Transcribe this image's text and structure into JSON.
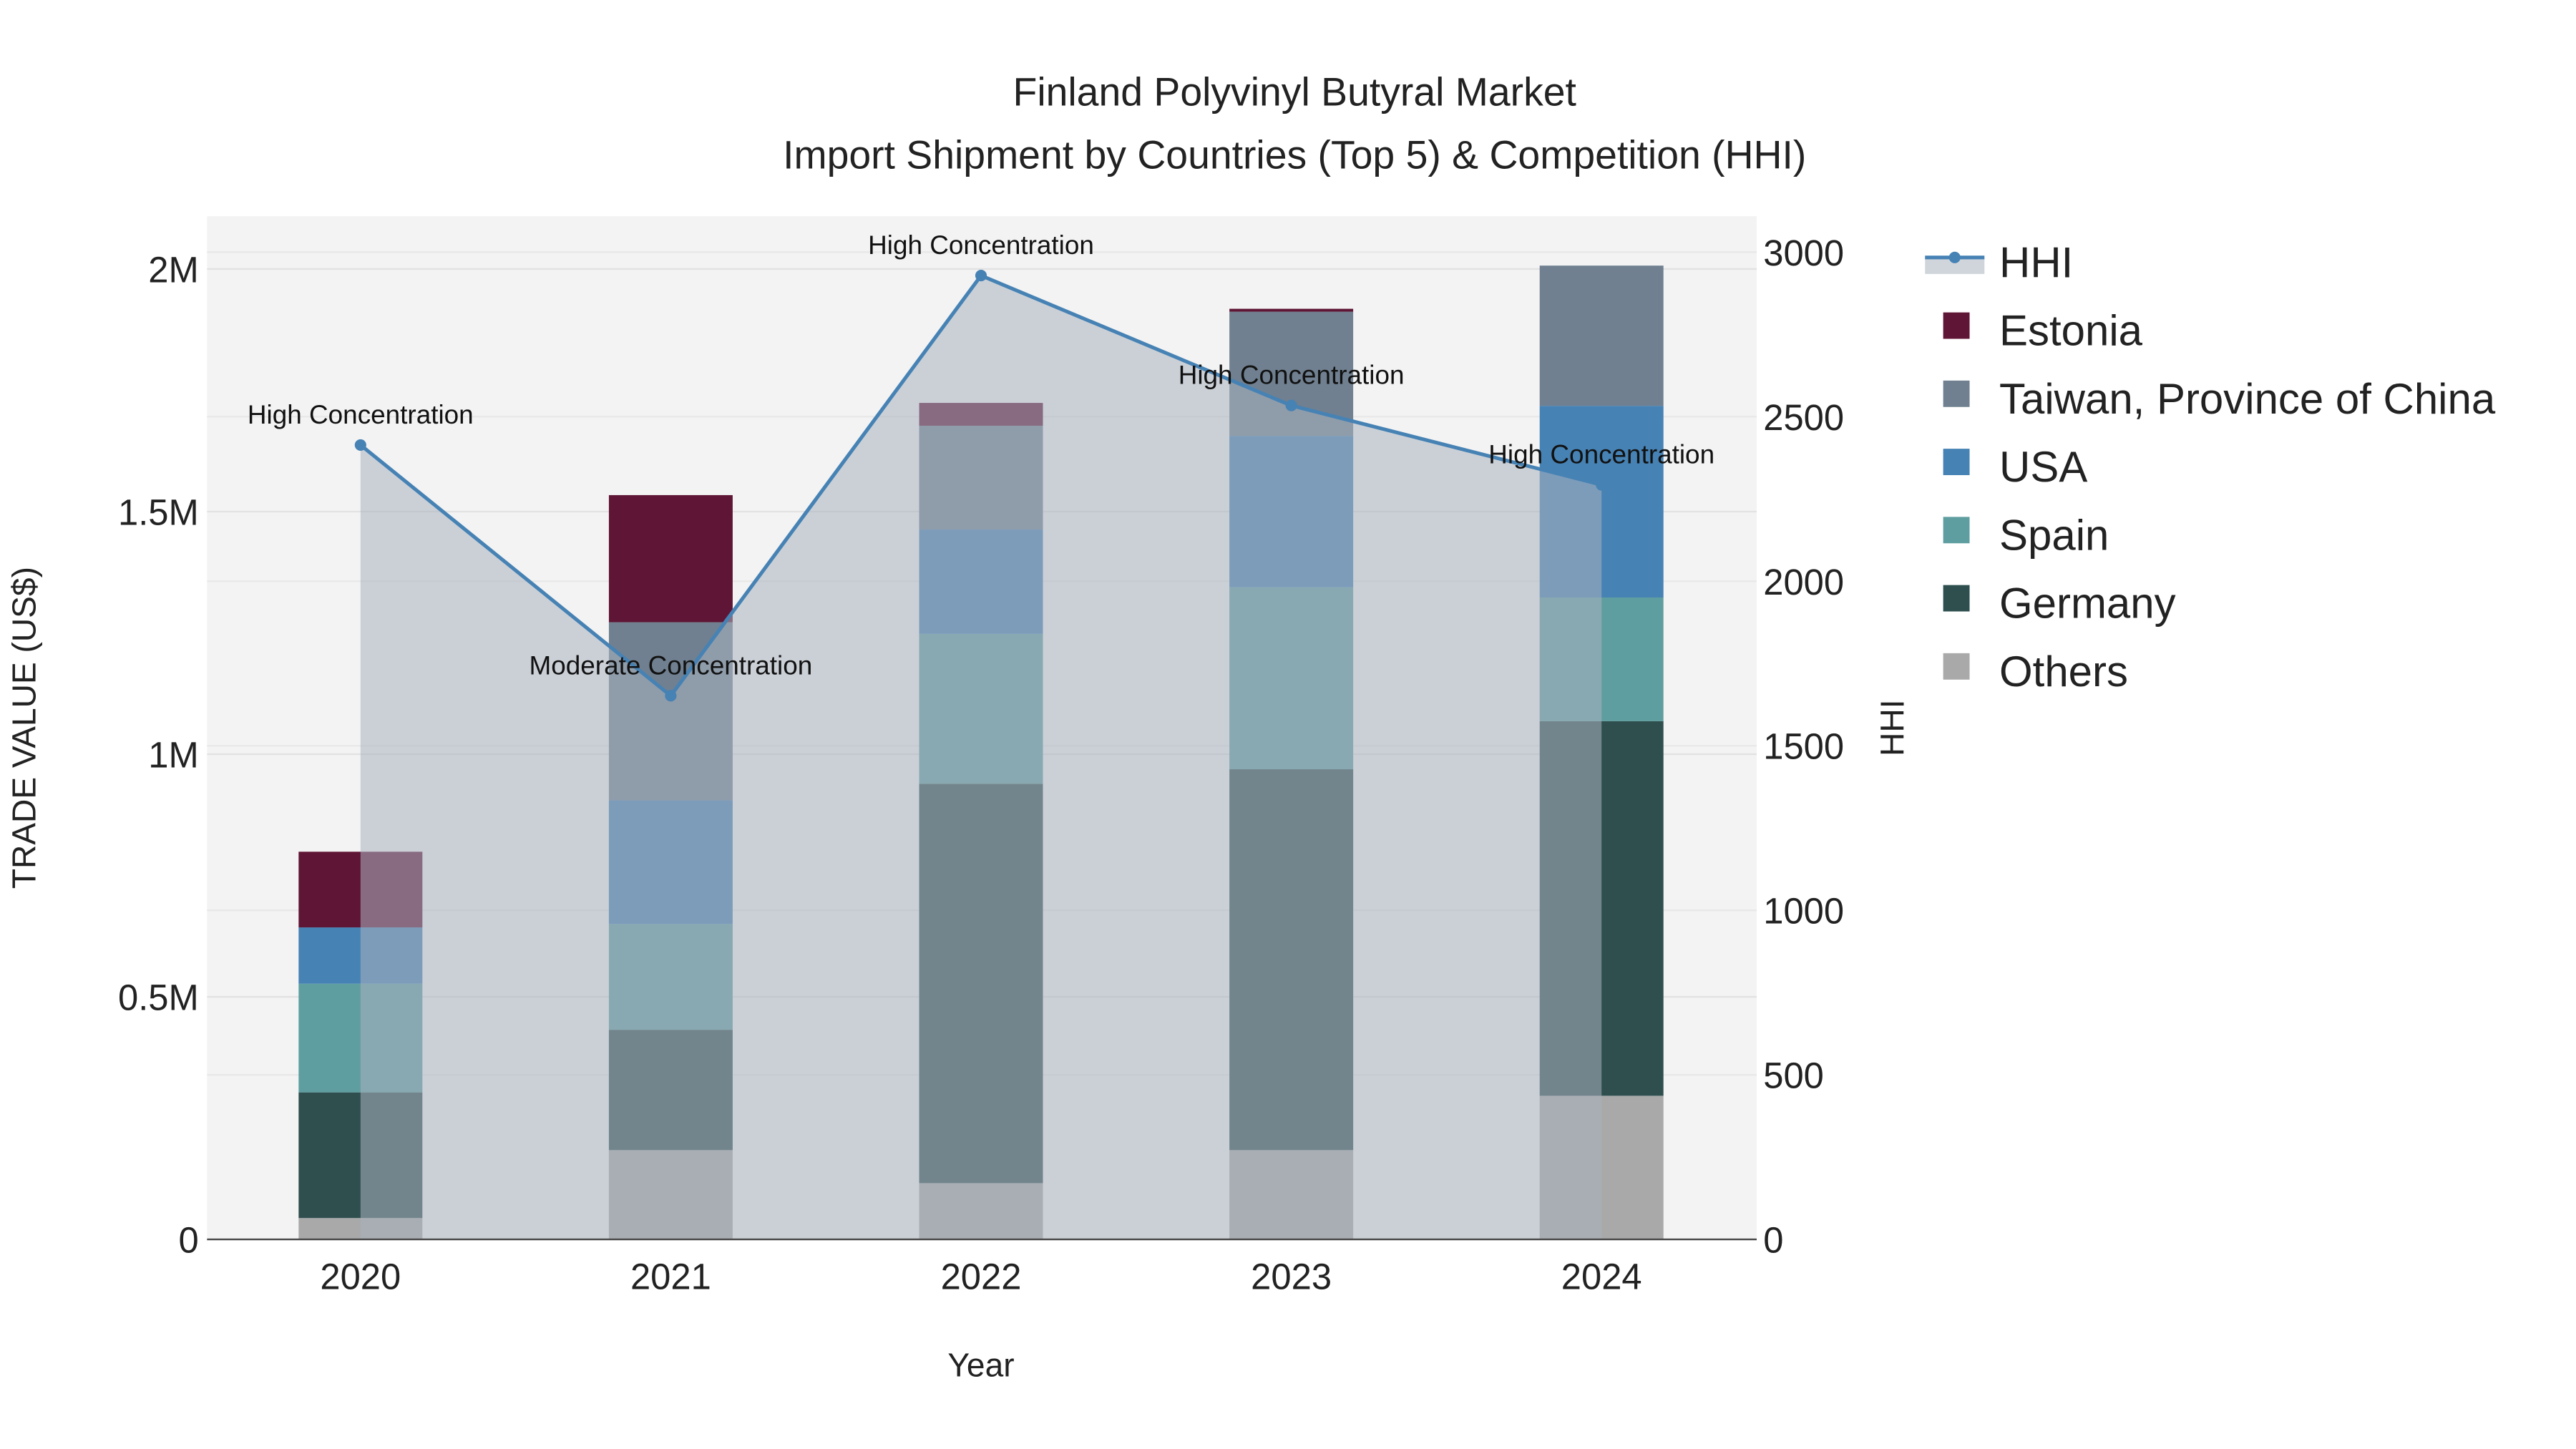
{
  "chart_data": {
    "type": "bar",
    "title": "Finland Polyvinyl Butyral Market",
    "subtitle": "Import Shipment by Countries (Top 5) & Competition (HHI)",
    "xlabel": "Year",
    "ylabel": "TRADE VALUE (US$)",
    "y2label": "HHI",
    "categories": [
      "2020",
      "2021",
      "2022",
      "2023",
      "2024"
    ],
    "ylim": [
      0,
      2100000
    ],
    "y2lim": [
      0,
      3100
    ],
    "yticks": [
      {
        "v": 0,
        "label": "0"
      },
      {
        "v": 500000,
        "label": "0.5M"
      },
      {
        "v": 1000000,
        "label": "1M"
      },
      {
        "v": 1500000,
        "label": "1.5M"
      },
      {
        "v": 2000000,
        "label": "2M"
      }
    ],
    "y2ticks": [
      {
        "v": 0,
        "label": "0"
      },
      {
        "v": 500,
        "label": "500"
      },
      {
        "v": 1000,
        "label": "1000"
      },
      {
        "v": 1500,
        "label": "1500"
      },
      {
        "v": 2000,
        "label": "2000"
      },
      {
        "v": 2500,
        "label": "2500"
      },
      {
        "v": 3000,
        "label": "3000"
      }
    ],
    "series": [
      {
        "name": "Others",
        "color": "#a9a9a9",
        "values": [
          44000,
          184000,
          116000,
          184000,
          296000
        ]
      },
      {
        "name": "Germany",
        "color": "#2f4f4f",
        "values": [
          259000,
          248000,
          823000,
          785000,
          772000
        ]
      },
      {
        "name": "Spain",
        "color": "#5f9ea0",
        "values": [
          224000,
          218000,
          309000,
          375000,
          255000
        ]
      },
      {
        "name": "USA",
        "color": "#4682b4",
        "values": [
          116000,
          255000,
          215000,
          312000,
          395000
        ]
      },
      {
        "name": "Taiwan, Province of China",
        "color": "#708090",
        "values": [
          0,
          367000,
          214000,
          256000,
          289000
        ]
      },
      {
        "name": "Estonia",
        "color": "#5f1535",
        "values": [
          156000,
          262000,
          47000,
          6000,
          0
        ]
      }
    ],
    "hhi": {
      "name": "HHI",
      "color": "#4682b4",
      "values": [
        2414,
        1652,
        2929,
        2534,
        2293
      ],
      "annotations": [
        "High Concentration",
        "Moderate Concentration",
        "High Concentration",
        "High Concentration",
        "High Concentration"
      ]
    },
    "legend_order": [
      "HHI",
      "Estonia",
      "Taiwan, Province of China",
      "USA",
      "Spain",
      "Germany",
      "Others"
    ],
    "legend_position": "right",
    "grid": true
  }
}
